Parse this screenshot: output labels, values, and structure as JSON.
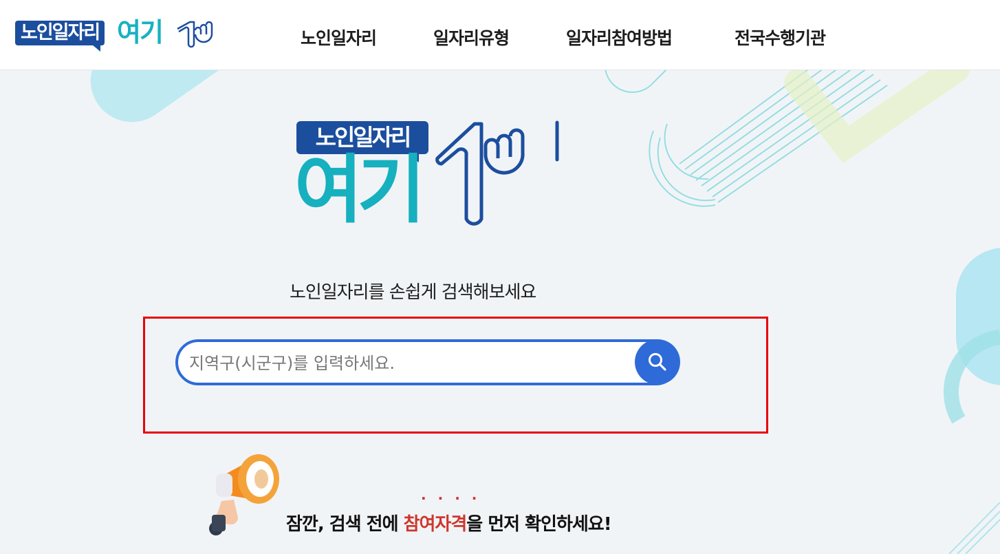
{
  "header": {
    "logo_badge": "노인일자리",
    "logo_text": "여기",
    "nav": [
      {
        "label": "노인일자리"
      },
      {
        "label": "일자리유형"
      },
      {
        "label": "일자리참여방법"
      },
      {
        "label": "전국수행기관"
      }
    ]
  },
  "hero": {
    "logo_badge": "노인일자리",
    "logo_text": "여기",
    "subtitle": "노인일자리를 손쉽게 검색해보세요"
  },
  "search": {
    "placeholder": "지역구(시군구)를 입력하세요.",
    "button_icon": "search-icon"
  },
  "notice": {
    "prefix": "잠깐, 검색 전에 ",
    "highlight": "참여자격",
    "suffix": "을 먼저 확인하세요!",
    "dots": "····",
    "icon": "megaphone-icon"
  },
  "colors": {
    "brand_navy": "#1c4e9e",
    "brand_teal": "#16b0bf",
    "search_blue": "#2f6bd8",
    "highlight_red": "#d0352c",
    "annotation_red": "#e8000b"
  }
}
